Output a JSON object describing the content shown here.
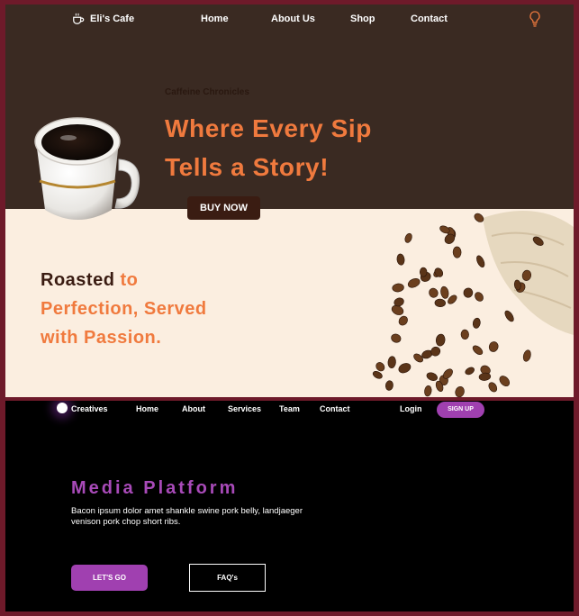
{
  "cafe": {
    "brand": "Eli's Cafe",
    "nav": [
      "Home",
      "About Us",
      "Shop",
      "Contact"
    ],
    "kicker": "Caffeine Chronicles",
    "headline_line1": "Where Every Sip",
    "headline_line2": "Tells a Story!",
    "buy_button": "BUY NOW",
    "tagline_dark": "Roasted",
    "tagline_accent1": "to",
    "tagline_line2": "Perfection, Served",
    "tagline_line3": "with Passion.",
    "colors": {
      "dark": "#3a2a22",
      "accent": "#f07a3e",
      "cream": "#fbeee0",
      "button": "#3a1c12"
    },
    "icons": {
      "brand": "coffee-cup-icon",
      "toggle": "lightbulb-icon"
    }
  },
  "creatives": {
    "brand": "Creatives",
    "nav": [
      "Home",
      "About",
      "Services",
      "Team",
      "Contact"
    ],
    "login": "Login",
    "signup": "SIGN UP",
    "title": "Media Platform",
    "body": "Bacon ipsum dolor amet shankle swine pork belly, landjaeger venison pork chop short ribs.",
    "primary_button": "LET'S GO",
    "secondary_button": "FAQ's",
    "colors": {
      "accent": "#a040b0",
      "background": "#000000"
    }
  }
}
